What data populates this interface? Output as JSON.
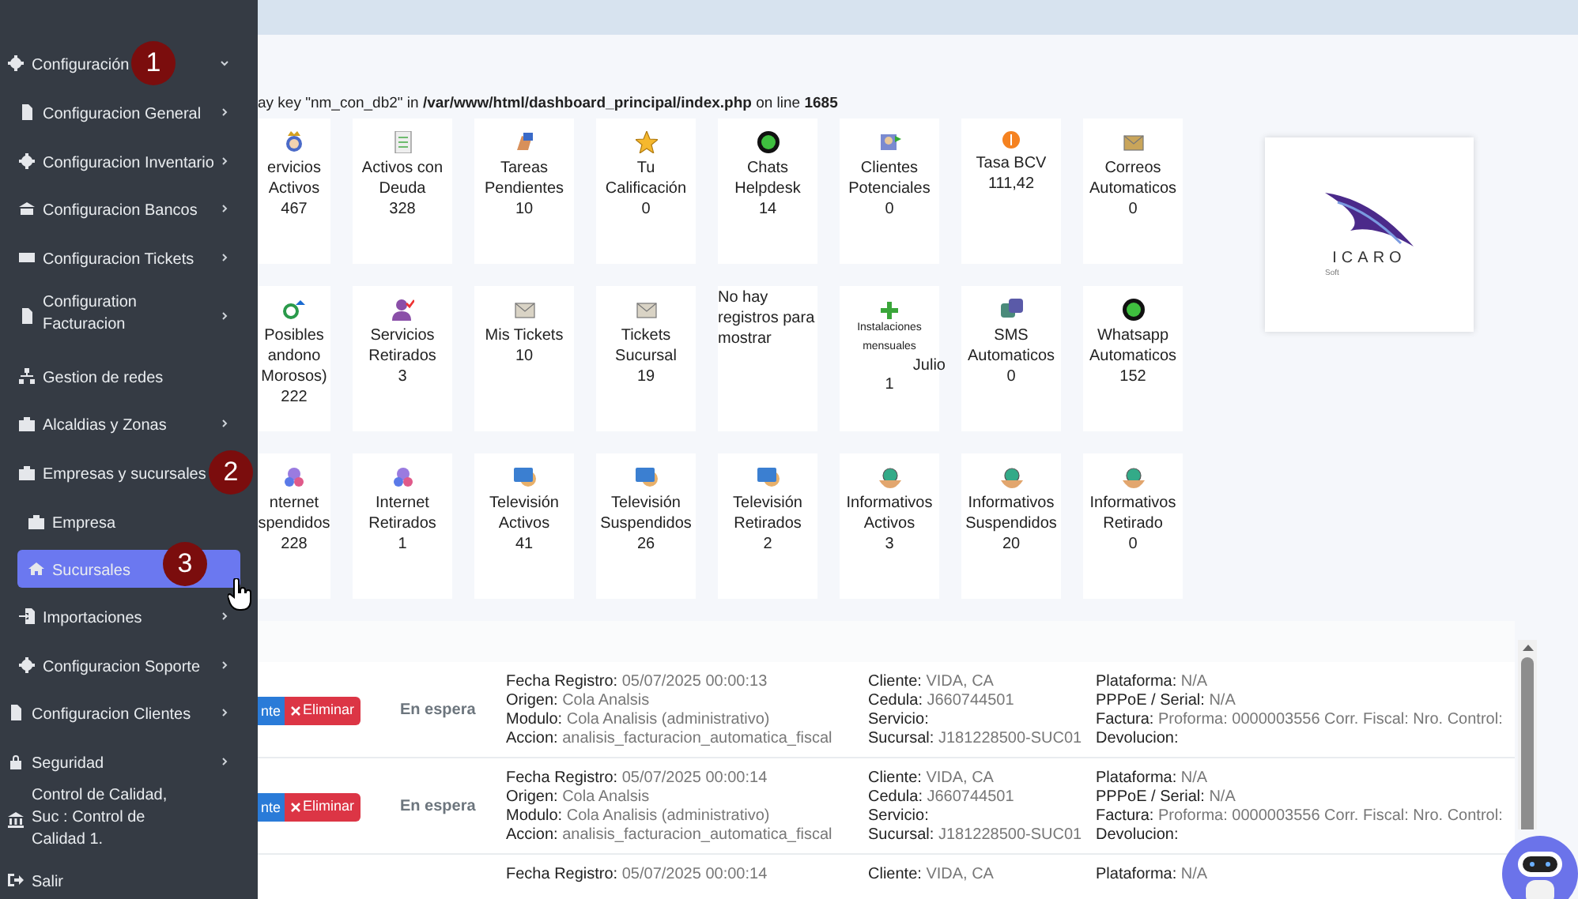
{
  "sidebar": {
    "items": [
      {
        "label": "Configuración",
        "arrow": true,
        "expanded": true,
        "badge": "1",
        "children": [
          {
            "label": "Configuracion General",
            "arrow": true
          },
          {
            "label": "Configuracion Inventario",
            "arrow": true
          },
          {
            "label": "Configuracion Bancos",
            "arrow": true
          },
          {
            "label": "Configuracion Tickets",
            "arrow": true
          },
          {
            "label": "Configuration Facturacion",
            "arrow": true
          },
          {
            "label": "Gestion de redes",
            "arrow": false
          },
          {
            "label": "Alcaldias y Zonas",
            "arrow": true
          },
          {
            "label": "Empresas y sucursales",
            "arrow": false,
            "expanded": true,
            "badge": "2",
            "children": [
              {
                "label": "Empresa",
                "selected": false
              },
              {
                "label": "Sucursales",
                "selected": true,
                "badge": "3"
              }
            ]
          },
          {
            "label": "Importaciones",
            "arrow": true
          },
          {
            "label": "Configuracion Soporte",
            "arrow": true
          }
        ]
      },
      {
        "label": "Configuracion Clientes",
        "arrow": true
      },
      {
        "label": "Seguridad",
        "arrow": true
      },
      {
        "label": "Control de Calidad, Suc : Control de Calidad 1.",
        "arrow": false
      },
      {
        "label": "Salir",
        "arrow": false
      }
    ]
  },
  "warning": "ay key \"nm_con_db2\" in **/var/www/html/dashboard_principal/index.php** on line **1685**",
  "cards": [
    {
      "kind": "stat",
      "label": "ervicios Activos",
      "value": "467"
    },
    {
      "kind": "stat",
      "label": "Activos con Deuda",
      "value": "328"
    },
    {
      "kind": "stat",
      "label": "Tareas Pendientes",
      "value": "10"
    },
    {
      "kind": "stat",
      "label": "Tu Calificación",
      "value": "0"
    },
    {
      "kind": "stat",
      "label": "Chats Helpdesk",
      "value": "14"
    },
    {
      "kind": "stat",
      "label": "Clientes Potenciales",
      "value": "0"
    },
    {
      "kind": "stat",
      "label": "Tasa BCV",
      "value": "111,42"
    },
    {
      "kind": "stat",
      "label": "Correos Automaticos",
      "value": "0"
    },
    {
      "kind": "stat",
      "label": "Posibles andono Morosos)",
      "value": "222"
    },
    {
      "kind": "stat",
      "label": "Servicios Retirados",
      "value": "3"
    },
    {
      "kind": "stat",
      "label": "Mis Tickets",
      "value": "10"
    },
    {
      "kind": "stat",
      "label": "Tickets Sucursal",
      "value": "19"
    },
    {
      "kind": "message",
      "label": "No hay registros para mostrar"
    },
    {
      "kind": "installs",
      "label": "Instalaciones mensuales",
      "month": "Julio",
      "value": "1"
    },
    {
      "kind": "stat",
      "label": "SMS Automaticos",
      "value": "0"
    },
    {
      "kind": "stat",
      "label": "Whatsapp Automaticos",
      "value": "152"
    },
    {
      "kind": "stat",
      "label": "nternet spendidos",
      "value": "228"
    },
    {
      "kind": "stat",
      "label": "Internet Retirados",
      "value": "1"
    },
    {
      "kind": "stat",
      "label": "Televisión Activos",
      "value": "41"
    },
    {
      "kind": "stat",
      "label": "Televisión Suspendidos",
      "value": "26"
    },
    {
      "kind": "stat",
      "label": "Televisión Retirados",
      "value": "2"
    },
    {
      "kind": "stat",
      "label": "Informativos Activos",
      "value": "3"
    },
    {
      "kind": "stat",
      "label": "Informativos Suspendidos",
      "value": "20"
    },
    {
      "kind": "stat",
      "label": "Informativos Retirado",
      "value": "0"
    }
  ],
  "logo": {
    "name": "ICARO",
    "sub": "Soft"
  },
  "table": {
    "rows": [
      {
        "buttons": [
          "nte",
          "Eliminar"
        ],
        "status": "En espera",
        "columns": [
          [
            {
              "label": "Fecha Registro:",
              "value": "05/07/2025 00:00:13"
            },
            {
              "label": "Origen:",
              "value": "Cola Analsis"
            },
            {
              "label": "Modulo:",
              "value": "Cola Analisis (administrativo)"
            },
            {
              "label": "Accion:",
              "value": "analisis_facturacion_automatica_fiscal"
            }
          ],
          [
            {
              "label": "Cliente:",
              "value": "VIDA, CA"
            },
            {
              "label": "Cedula:",
              "value": "J660744501"
            },
            {
              "label": "Servicio:"
            },
            {
              "label": "Sucursal:",
              "value": "J181228500-SUC01"
            }
          ],
          [
            {
              "label": "Plataforma:",
              "value": "N/A"
            },
            {
              "label": "PPPoE / Serial:",
              "value": "N/A"
            },
            {
              "label": "Factura:",
              "value": "Proforma: 0000003556 Corr. Fiscal: Nro. Control:"
            },
            {
              "label": "Devolucion:"
            }
          ]
        ]
      },
      {
        "buttons": [
          "nte",
          "Eliminar"
        ],
        "status": "En espera",
        "columns": [
          [
            {
              "label": "Fecha Registro:",
              "value": "05/07/2025 00:00:14"
            },
            {
              "label": "Origen:",
              "value": "Cola Analsis"
            },
            {
              "label": "Modulo:",
              "value": "Cola Analisis (administrativo)"
            },
            {
              "label": "Accion:",
              "value": "analisis_facturacion_automatica_fiscal"
            }
          ],
          [
            {
              "label": "Cliente:",
              "value": "VIDA, CA"
            },
            {
              "label": "Cedula:",
              "value": "J660744501"
            },
            {
              "label": "Servicio:"
            },
            {
              "label": "Sucursal:",
              "value": "J181228500-SUC01"
            }
          ],
          [
            {
              "label": "Plataforma:",
              "value": "N/A"
            },
            {
              "label": "PPPoE / Serial:",
              "value": "N/A"
            },
            {
              "label": "Factura:",
              "value": "Proforma: 0000003556 Corr. Fiscal: Nro. Control:"
            },
            {
              "label": "Devolucion:"
            }
          ]
        ]
      },
      {
        "status": "",
        "columns": [
          [
            {
              "label": "Fecha Registro:",
              "value": "05/07/2025 00:00:14"
            }
          ],
          [
            {
              "label": "Cliente:",
              "value": "VIDA, CA"
            }
          ],
          [
            {
              "label": "Plataforma:",
              "value": "N/A"
            }
          ]
        ]
      }
    ]
  }
}
